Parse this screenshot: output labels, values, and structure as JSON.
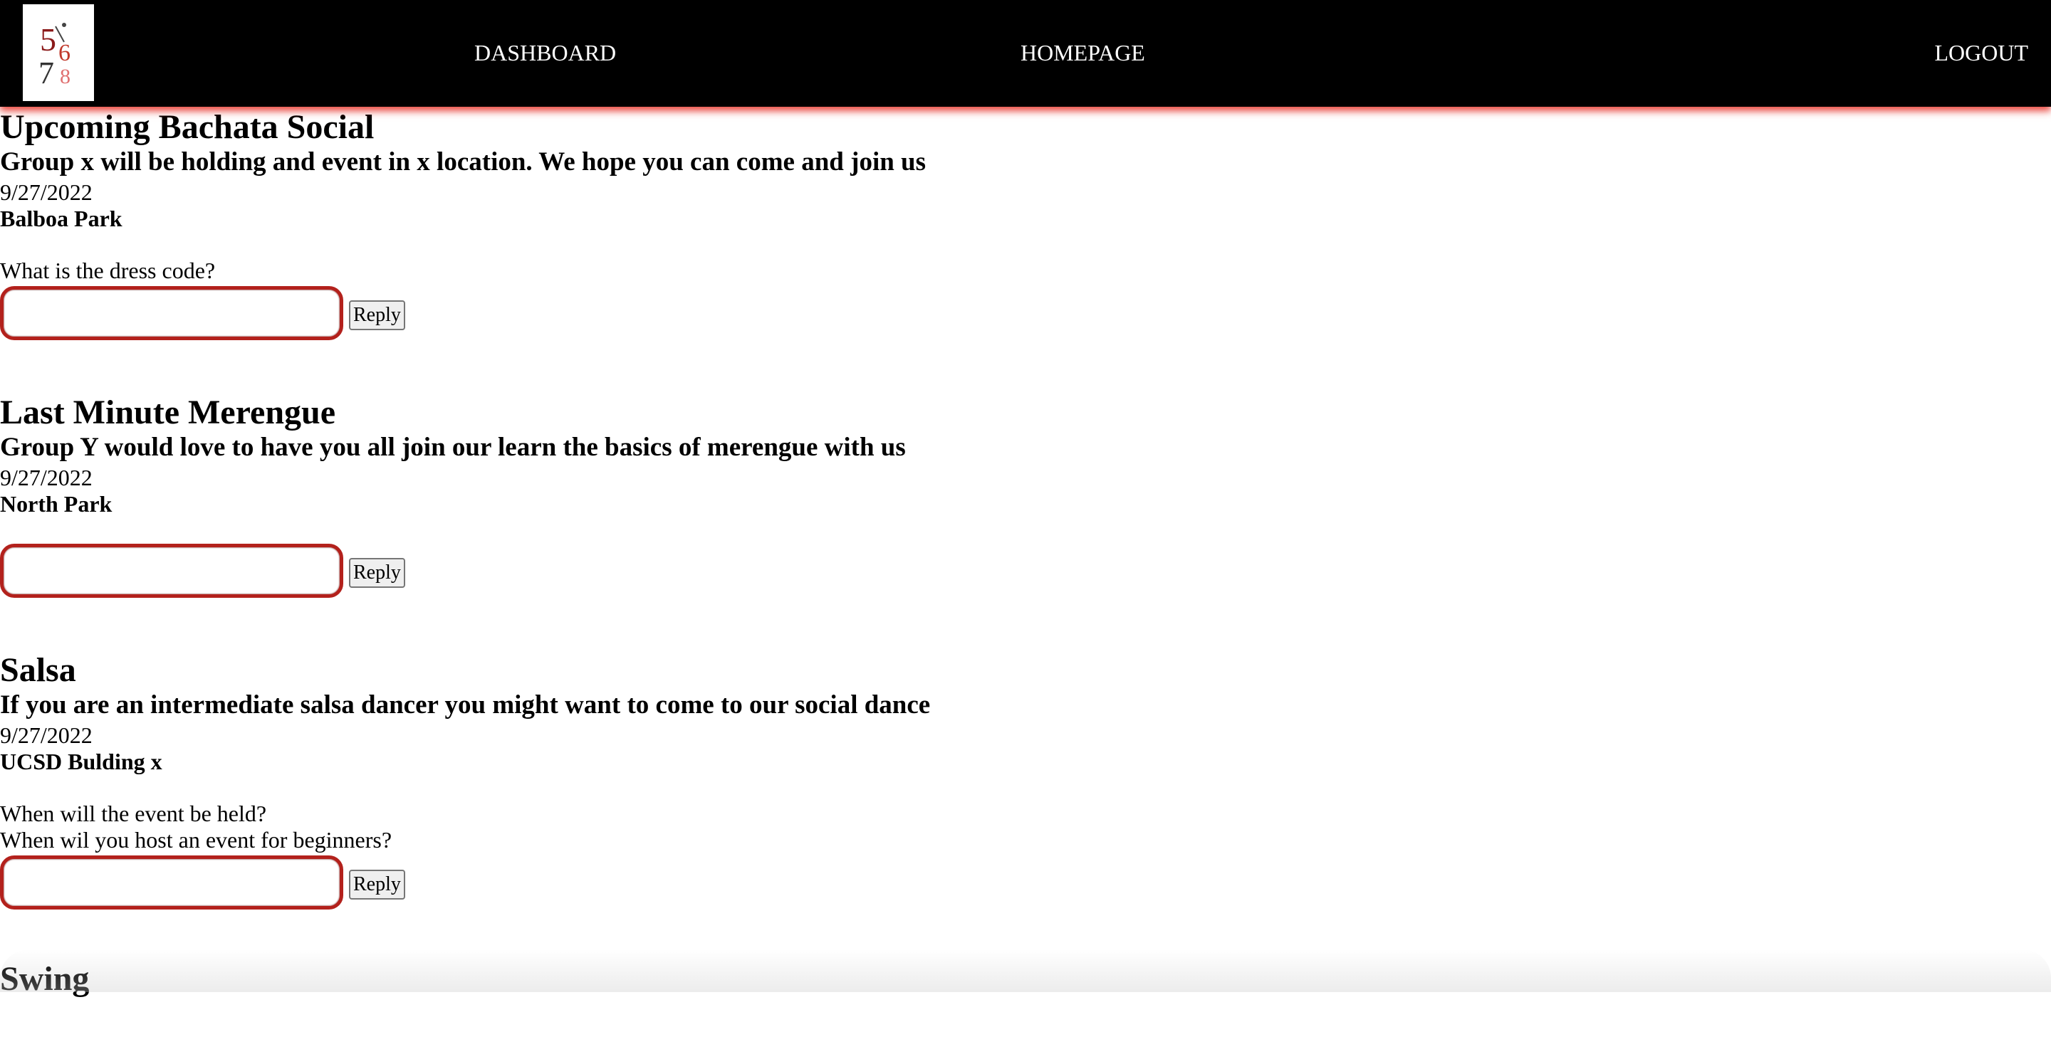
{
  "nav": {
    "logo_alt": "5678",
    "links": [
      "DASHBOARD",
      "HOMEPAGE",
      "LOGOUT"
    ]
  },
  "events": [
    {
      "title": "Upcoming Bachata Social",
      "description": "Group x will be holding and event in x location. We hope you can come and join us",
      "date": "9/27/2022",
      "location": "Balboa Park",
      "comments": [
        "What is the dress code?"
      ],
      "reply_label": "Reply",
      "reply_value": ""
    },
    {
      "title": "Last Minute Merengue",
      "description": "Group Y would love to have you all join our learn the basics of merengue with us",
      "date": "9/27/2022",
      "location": "North Park",
      "comments": [],
      "reply_label": "Reply",
      "reply_value": ""
    },
    {
      "title": "Salsa",
      "description": "If you are an intermediate salsa dancer you might want to come to our social dance",
      "date": "9/27/2022",
      "location": "UCSD Bulding x",
      "comments": [
        "When will the event be held?",
        "When wil you host an event for beginners?"
      ],
      "reply_label": "Reply",
      "reply_value": ""
    },
    {
      "title": "Swing",
      "description": "",
      "date": "",
      "location": "",
      "comments": [],
      "reply_label": "",
      "reply_value": ""
    }
  ],
  "colors": {
    "nav_bg": "#000000",
    "nav_shadow": "#e6281e",
    "input_border": "#b3211c"
  }
}
